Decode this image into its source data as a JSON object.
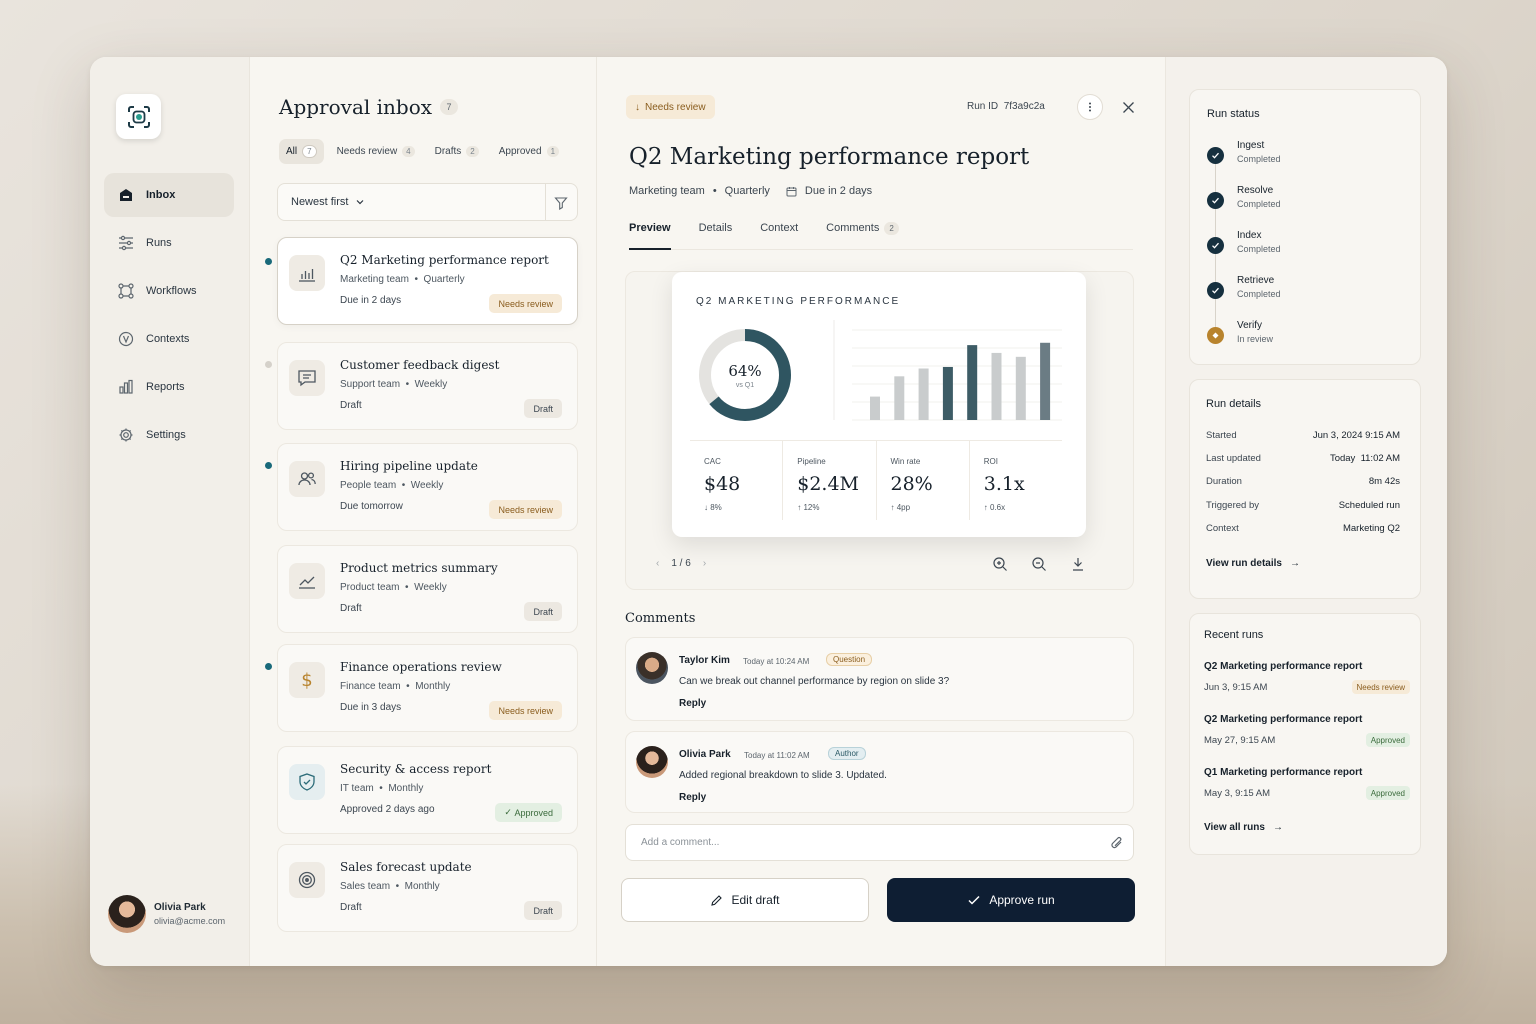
{
  "nav": {
    "items": [
      {
        "label": "Inbox",
        "icon": "inbox-icon"
      },
      {
        "label": "Runs",
        "icon": "runs-icon"
      },
      {
        "label": "Workflows",
        "icon": "workflows-icon"
      },
      {
        "label": "Contexts",
        "icon": "contexts-icon"
      },
      {
        "label": "Reports",
        "icon": "reports-icon"
      },
      {
        "label": "Settings",
        "icon": "gear-icon"
      }
    ],
    "user": {
      "name": "Olivia Park",
      "email": "olivia@acme.com"
    }
  },
  "inbox": {
    "title": "Approval inbox",
    "count": "7",
    "filters": [
      {
        "label": "All",
        "count": "7"
      },
      {
        "label": "Needs review",
        "count": "4"
      },
      {
        "label": "Drafts",
        "count": "2"
      },
      {
        "label": "Approved",
        "count": "1"
      }
    ],
    "sort": "Newest first",
    "items": [
      {
        "title": "Q2 Marketing performance report",
        "team": "Marketing team",
        "cadence": "Quarterly",
        "due": "Due in 2 days",
        "status": "Needs review",
        "icon": "bar-chart-icon"
      },
      {
        "title": "Customer feedback digest",
        "team": "Support team",
        "cadence": "Weekly",
        "due": "Draft",
        "status": "Draft",
        "icon": "message-icon"
      },
      {
        "title": "Hiring pipeline update",
        "team": "People team",
        "cadence": "Weekly",
        "due": "Due tomorrow",
        "status": "Needs review",
        "icon": "users-icon"
      },
      {
        "title": "Product metrics summary",
        "team": "Product team",
        "cadence": "Weekly",
        "due": "Draft",
        "status": "Draft",
        "icon": "trend-icon"
      },
      {
        "title": "Finance operations review",
        "team": "Finance team",
        "cadence": "Monthly",
        "due": "Due in 3 days",
        "status": "Needs review",
        "icon": "dollar-icon"
      },
      {
        "title": "Security & access report",
        "team": "IT team",
        "cadence": "Monthly",
        "due": "Approved 2 days ago",
        "status": "Approved",
        "icon": "shield-icon"
      },
      {
        "title": "Sales forecast update",
        "team": "Sales team",
        "cadence": "Monthly",
        "due": "Draft",
        "status": "Draft",
        "icon": "target-icon"
      }
    ]
  },
  "detail": {
    "status": "Needs review",
    "run_id_label": "Run ID",
    "run_id": "7f3a9c2a",
    "title": "Q2 Marketing performance report",
    "team": "Marketing team",
    "cadence": "Quarterly",
    "due": "Due in 2 days",
    "tabs": [
      {
        "label": "Preview"
      },
      {
        "label": "Details"
      },
      {
        "label": "Context"
      },
      {
        "label": "Comments",
        "count": "2"
      }
    ],
    "slide": {
      "title": "Q2 MARKETING PERFORMANCE",
      "donut_value": "64%",
      "donut_fraction": 0.64,
      "donut_sub": "vs Q1",
      "bars": [
        0.3,
        0.56,
        0.66,
        0.68,
        0.96,
        0.86,
        0.81,
        0.99
      ],
      "bar_colors": [
        "#c9cccd",
        "#c9cccd",
        "#c9cccd",
        "#3d5c66",
        "#3d5c66",
        "#c9cccd",
        "#c9cccd",
        "#6b7c84"
      ],
      "metrics": [
        {
          "label": "CAC",
          "value": "$48",
          "delta": "↓ 8%"
        },
        {
          "label": "Pipeline",
          "value": "$2.4M",
          "delta": "↑ 12%"
        },
        {
          "label": "Win rate",
          "value": "28%",
          "delta": "↑ 4pp"
        },
        {
          "label": "ROI",
          "value": "3.1x",
          "delta": "↑ 0.6x"
        }
      ]
    },
    "pager": "1 / 6",
    "comments_title": "Comments",
    "comments": [
      {
        "author": "Taylor Kim",
        "time": "Today at 10:24 AM",
        "tag": "Question",
        "body": "Can we break out channel performance by region on slide 3?",
        "reply": "Reply"
      },
      {
        "author": "Olivia Park",
        "time": "Today at 11:02 AM",
        "tag": "Author",
        "body": "Added regional breakdown to slide 3. Updated.",
        "reply": "Reply"
      }
    ],
    "add_comment_placeholder": "Add a comment...",
    "edit_label": "Edit draft",
    "approve_label": "Approve run"
  },
  "run_status": {
    "title": "Run status",
    "steps": [
      {
        "name": "Ingest",
        "state": "Completed"
      },
      {
        "name": "Resolve",
        "state": "Completed"
      },
      {
        "name": "Index",
        "state": "Completed"
      },
      {
        "name": "Retrieve",
        "state": "Completed"
      },
      {
        "name": "Verify",
        "state": "In review"
      }
    ]
  },
  "run_details": {
    "title": "Run details",
    "rows": [
      {
        "label": "Started",
        "value": "Jun 3, 2024 9:15 AM"
      },
      {
        "label": "Last updated",
        "value": "Today  11:02 AM"
      },
      {
        "label": "Duration",
        "value": "8m 42s"
      },
      {
        "label": "Triggered by",
        "value": "Scheduled run"
      },
      {
        "label": "Context",
        "value": "Marketing Q2"
      }
    ],
    "link": "View run details"
  },
  "recent_runs": {
    "title": "Recent runs",
    "items": [
      {
        "title": "Q2 Marketing performance report",
        "date": "Jun 3, 9:15 AM",
        "status": "Needs review"
      },
      {
        "title": "Q2 Marketing performance report",
        "date": "May 27, 9:15 AM",
        "status": "Approved"
      },
      {
        "title": "Q1 Marketing performance report",
        "date": "May 3, 9:15 AM",
        "status": "Approved"
      }
    ],
    "link": "View all runs"
  }
}
